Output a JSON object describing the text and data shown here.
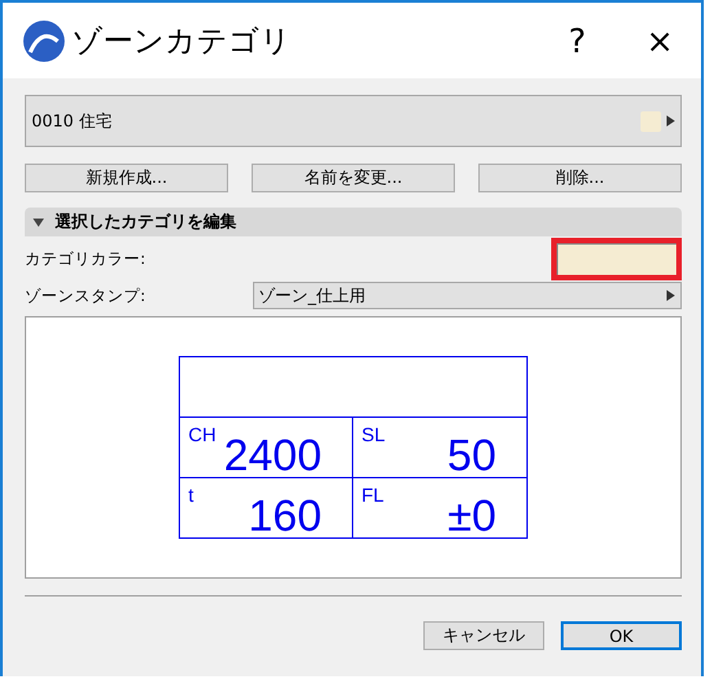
{
  "window": {
    "title": "ゾーンカテゴリ",
    "help": "?",
    "close": "×"
  },
  "category": {
    "label": "0010  住宅",
    "color": "#f5ecd2"
  },
  "buttons": [
    "新規作成...",
    "名前を変更...",
    "削除..."
  ],
  "section": {
    "title": "選択したカテゴリを編集",
    "expanded": true
  },
  "category_color": {
    "label": "カテゴリカラー:",
    "color": "#f5ecd2",
    "highlighted": true
  },
  "zone_stamp": {
    "label": "ゾーンスタンプ:",
    "value": "ゾーン_仕上用"
  },
  "stamp_preview": {
    "cells": [
      {
        "label": "CH",
        "value": "2400"
      },
      {
        "label": "SL",
        "value": "50"
      },
      {
        "label": "t",
        "value": "160"
      },
      {
        "label": "FL",
        "value": "±0"
      }
    ]
  },
  "footer_buttons": [
    {
      "label": "キャンセル",
      "default": false
    },
    {
      "label": "OK",
      "default": true
    }
  ]
}
